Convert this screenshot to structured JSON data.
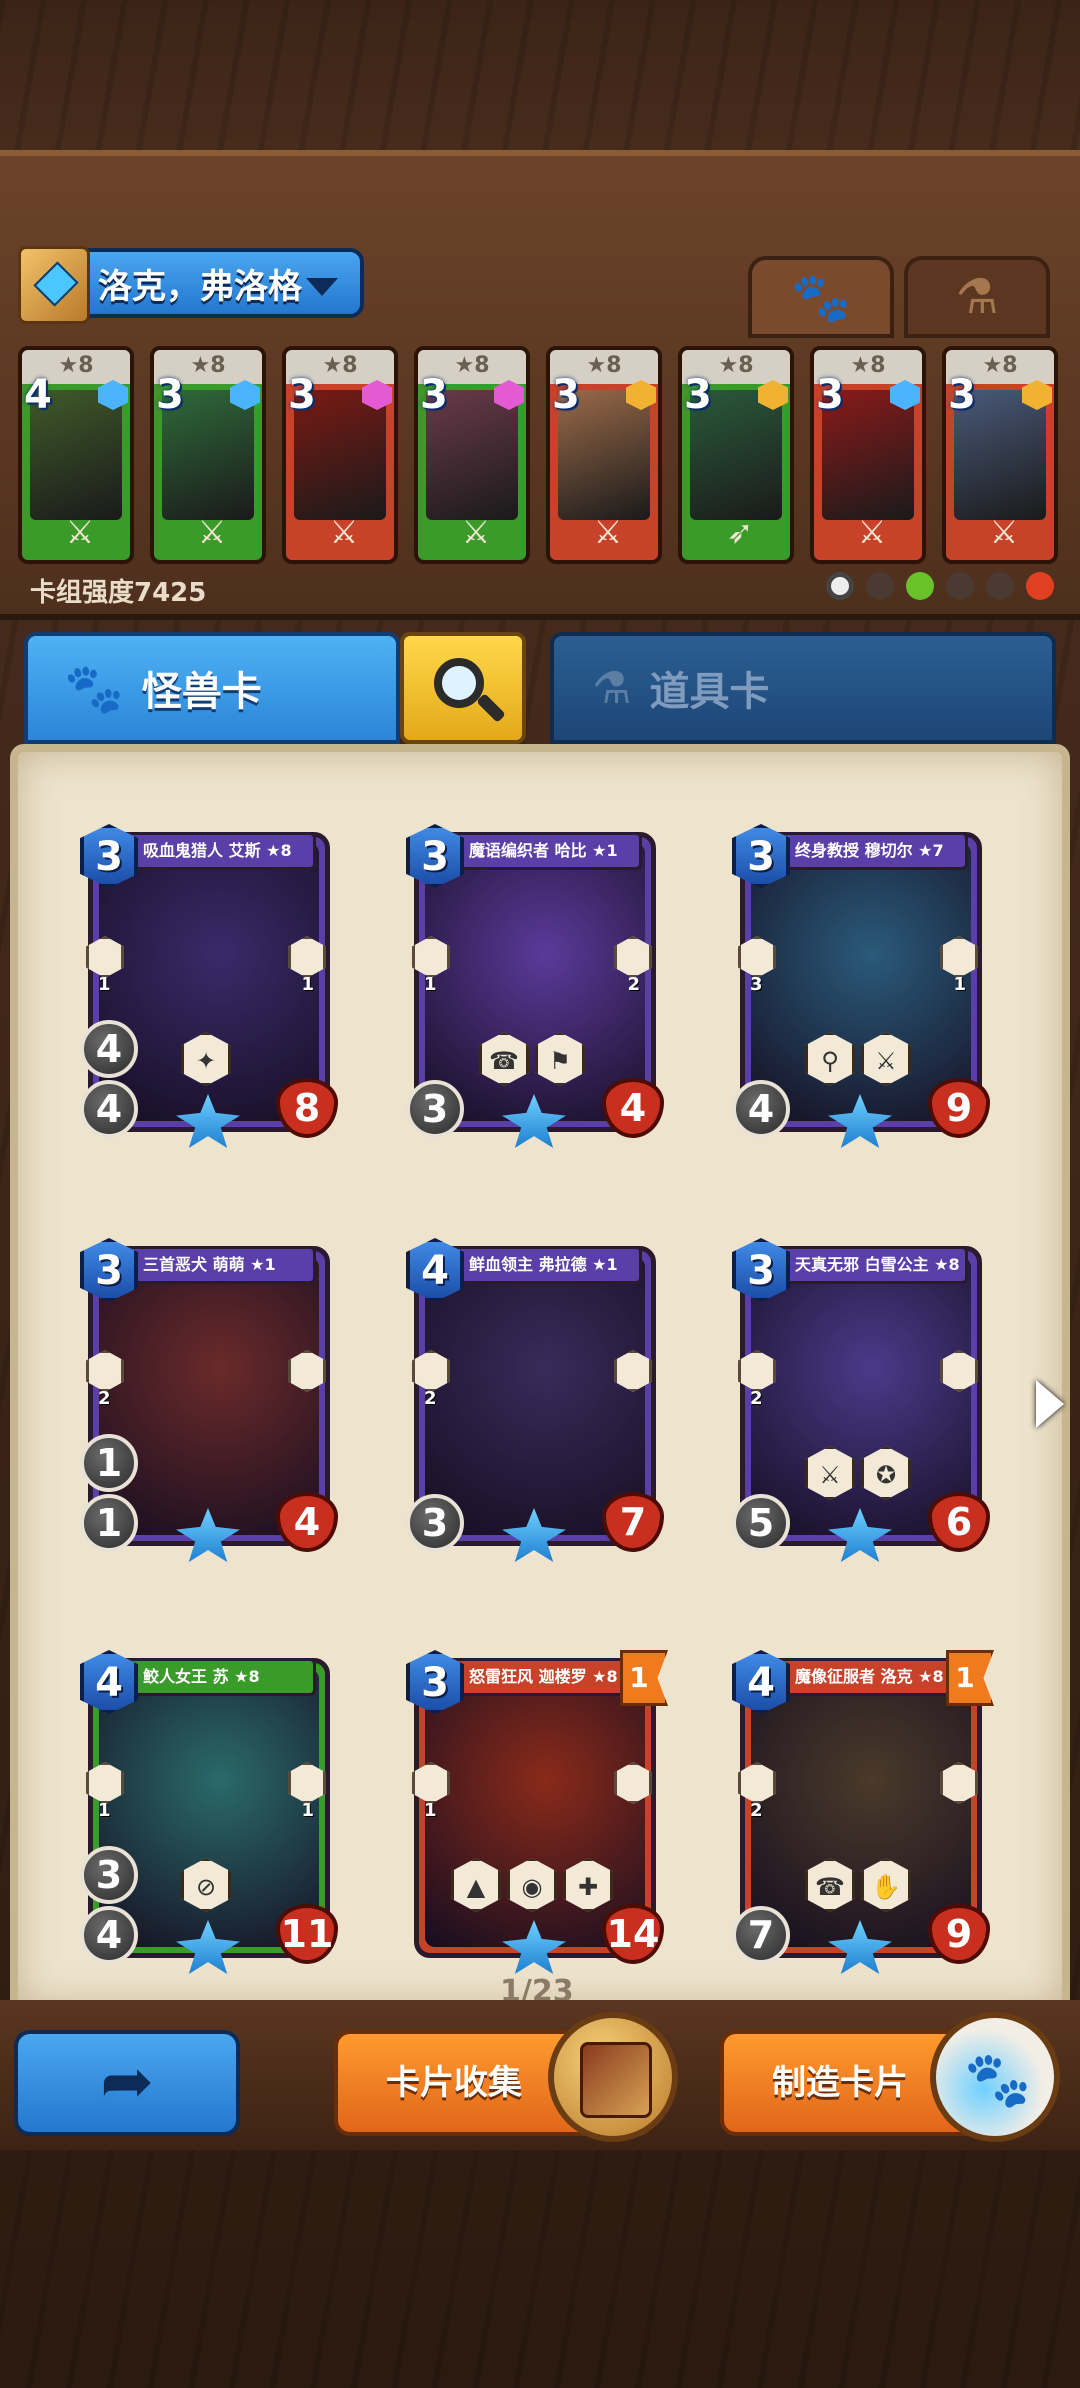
{
  "deck": {
    "name": "洛克，弗洛格",
    "strength_label": "卡组强度7425",
    "tabs": {
      "monster_icon": "paw-icon",
      "item_icon": "potion-icon"
    },
    "cards": [
      {
        "cost": "4",
        "star": "★8",
        "frame": "#3a9a2a",
        "gem": "#4ab4ff",
        "art": "#3f5a2a",
        "weapon": "sword"
      },
      {
        "cost": "3",
        "star": "★8",
        "frame": "#3a9a2a",
        "gem": "#4ab4ff",
        "art": "#2f6a3a",
        "weapon": "sword"
      },
      {
        "cost": "3",
        "star": "★8",
        "frame": "#c8422a",
        "gem": "#e35ad2",
        "art": "#7a1a14",
        "weapon": "sword"
      },
      {
        "cost": "3",
        "star": "★8",
        "frame": "#3a9a2a",
        "gem": "#e35ad2",
        "art": "#6a3a4a",
        "weapon": "sword"
      },
      {
        "cost": "3",
        "star": "★8",
        "frame": "#c8422a",
        "gem": "#f2b231",
        "art": "#9a6a4a",
        "weapon": "sword"
      },
      {
        "cost": "3",
        "star": "★8",
        "frame": "#3a9a2a",
        "gem": "#f2b231",
        "art": "#2a5a3a",
        "weapon": "bow"
      },
      {
        "cost": "3",
        "star": "★8",
        "frame": "#c8422a",
        "gem": "#4ab4ff",
        "art": "#8a1a1a",
        "weapon": "sword"
      },
      {
        "cost": "3",
        "star": "★8",
        "frame": "#c8422a",
        "gem": "#f2b231",
        "art": "#4a5a7a",
        "weapon": "sword"
      }
    ]
  },
  "tabs": {
    "monster_label": "怪兽卡",
    "item_label": "道具卡"
  },
  "collection": [
    {
      "name": "吸血鬼猎人 艾斯 ★8",
      "cost": "3",
      "atk1": "4",
      "atk2": "4",
      "hp": "8",
      "left": "1",
      "right": "1",
      "frame": "#5a3fa8",
      "art": "#3a2a6a",
      "abilities": [
        "✦"
      ],
      "flag": ""
    },
    {
      "name": "魔语编织者 哈比 ★1",
      "cost": "3",
      "atk1": "",
      "atk2": "3",
      "hp": "4",
      "left": "1",
      "right": "2",
      "frame": "#5a3fa8",
      "art": "#5a3a9a",
      "abilities": [
        "☎",
        "⚑"
      ],
      "flag": ""
    },
    {
      "name": "终身教授 穆切尔 ★7",
      "cost": "3",
      "atk1": "",
      "atk2": "4",
      "hp": "9",
      "left": "3",
      "right": "1",
      "frame": "#5a3fa8",
      "art": "#2a5a7a",
      "abilities": [
        "⚲",
        "⚔"
      ],
      "flag": ""
    },
    {
      "name": "三首恶犬 萌萌 ★1",
      "cost": "3",
      "atk1": "1",
      "atk2": "1",
      "hp": "4",
      "left": "2",
      "right": "",
      "frame": "#5a3fa8",
      "art": "#6a2a2a",
      "abilities": [],
      "flag": ""
    },
    {
      "name": "鲜血领主 弗拉德 ★1",
      "cost": "4",
      "atk1": "",
      "atk2": "3",
      "hp": "7",
      "left": "2",
      "right": "",
      "frame": "#5a3fa8",
      "art": "#3a2a5a",
      "abilities": [],
      "flag": ""
    },
    {
      "name": "天真无邪 白雪公主 ★8",
      "cost": "3",
      "atk1": "",
      "atk2": "5",
      "hp": "6",
      "left": "2",
      "right": "",
      "frame": "#5a3fa8",
      "art": "#4a3a8a",
      "abilities": [
        "⚔",
        "✪"
      ],
      "flag": ""
    },
    {
      "name": "鲛人女王 苏 ★8",
      "cost": "4",
      "atk1": "3",
      "atk2": "4",
      "hp": "11",
      "left": "1",
      "right": "1",
      "frame": "#3a9a2a",
      "art": "#2a6a6a",
      "abilities": [
        "⊘"
      ],
      "flag": ""
    },
    {
      "name": "怒雷狂风 迦楼罗 ★8",
      "cost": "3",
      "atk1": "",
      "atk2": "",
      "hp": "14",
      "left": "1",
      "right": "",
      "frame": "#c8422a",
      "art": "#8a2a1a",
      "abilities": [
        "▲",
        "◉",
        "✚"
      ],
      "flag": "1"
    },
    {
      "name": "魔像征服者 洛克 ★8",
      "cost": "4",
      "atk1": "",
      "atk2": "7",
      "hp": "9",
      "left": "2",
      "right": "",
      "frame": "#c8422a",
      "art": "#4a3a2a",
      "abilities": [
        "☎",
        "✋"
      ],
      "flag": "1"
    }
  ],
  "pagination": {
    "text": "1/23"
  },
  "bottom": {
    "back_icon": "back-arrow-icon",
    "collect_label": "卡片收集",
    "craft_label": "制造卡片"
  }
}
